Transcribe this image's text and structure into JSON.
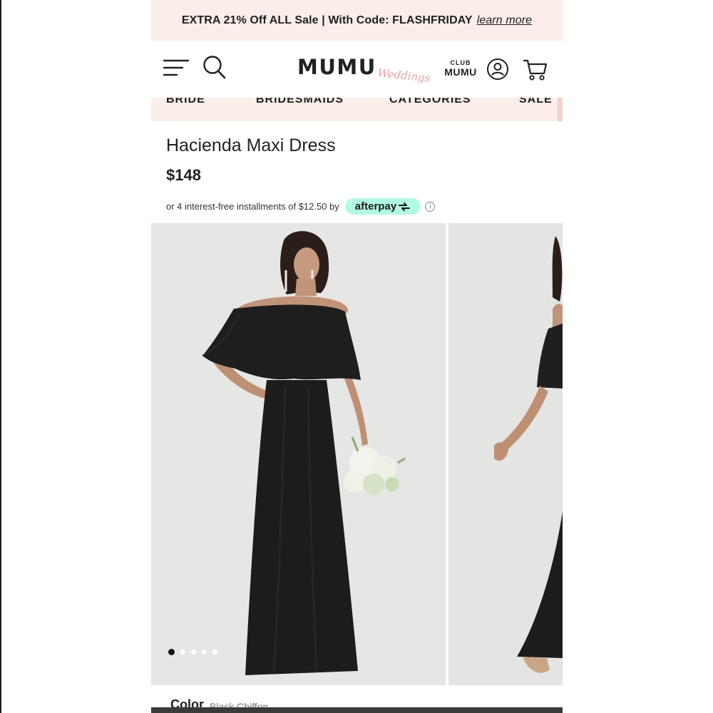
{
  "promo": {
    "text": "EXTRA 21% Off ALL Sale | With Code: FLASHFRIDAY",
    "link": "learn more"
  },
  "header": {
    "logo_main": "MUMU",
    "logo_sub": "Weddings",
    "club_top": "CLUB",
    "club_bottom": "MUMU"
  },
  "nav": {
    "items": [
      "BRIDE",
      "BRIDESMAIDS",
      "CATEGORIES",
      "SALE"
    ]
  },
  "product": {
    "title": "Hacienda Maxi Dress",
    "price": "$148",
    "installments": "or 4 interest-free installments of $12.50 by",
    "afterpay_label": "afterpay",
    "info_symbol": "i",
    "color_label": "Color",
    "color_value": "Black Chiffon"
  },
  "gallery": {
    "image_count": 5,
    "active_index": 0
  },
  "colors": {
    "promo_bg": "#fbeeea",
    "afterpay": "#b2fce4",
    "dress": "#1c1c1c",
    "photo_bg": "#e6e6e5"
  },
  "icons": [
    "menu-icon",
    "search-icon",
    "account-icon",
    "cart-icon",
    "afterpay-arrow-icon",
    "info-icon"
  ]
}
